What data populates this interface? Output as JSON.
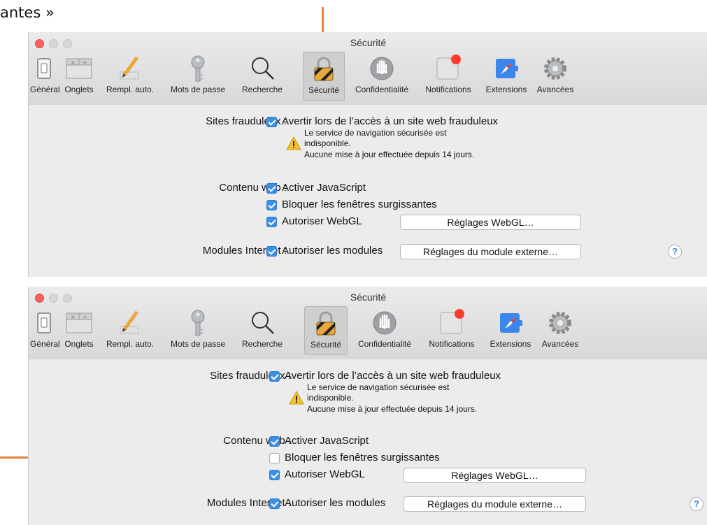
{
  "header_text": "antes »",
  "windows": [
    {
      "title": "Sécurité",
      "toolbar": [
        {
          "label": "Général",
          "icon": "general-switch-icon"
        },
        {
          "label": "Onglets",
          "icon": "tabs-icon"
        },
        {
          "label": "Rempl. auto.",
          "icon": "autofill-pencil-icon"
        },
        {
          "label": "Mots de passe",
          "icon": "key-icon"
        },
        {
          "label": "Recherche",
          "icon": "search-icon"
        },
        {
          "label": "Sécurité",
          "icon": "lock-icon",
          "selected": true
        },
        {
          "label": "Confidentialité",
          "icon": "hand-icon"
        },
        {
          "label": "Notifications",
          "icon": "notification-icon"
        },
        {
          "label": "Extensions",
          "icon": "extensions-compass-icon"
        },
        {
          "label": "Avancées",
          "icon": "gear-icon"
        }
      ],
      "fraud_label": "Sites frauduleux :",
      "fraud_option": "Avertir lors de l’accès à un site web frauduleux",
      "fraud_checked": true,
      "warning_line1": "Le service de navigation sécurisée est",
      "warning_line2": "indisponible.",
      "warning_line3": "Aucune mise à jour effectuée depuis 14 jours.",
      "web_label": "Contenu web :",
      "js_option": "Activer JavaScript",
      "js_checked": true,
      "popup_option": "Bloquer les fenêtres surgissantes",
      "popup_checked": true,
      "webgl_option": "Autoriser WebGL",
      "webgl_checked": true,
      "webgl_button": "Réglages WebGL…",
      "modules_label": "Modules Internet :",
      "modules_option": "Autoriser les modules",
      "modules_checked": true,
      "modules_button": "Réglages du module externe…",
      "help": "?"
    },
    {
      "title": "Sécurité",
      "toolbar": [
        {
          "label": "Général",
          "icon": "general-switch-icon"
        },
        {
          "label": "Onglets",
          "icon": "tabs-icon"
        },
        {
          "label": "Rempl. auto.",
          "icon": "autofill-pencil-icon"
        },
        {
          "label": "Mots de passe",
          "icon": "key-icon"
        },
        {
          "label": "Recherche",
          "icon": "search-icon"
        },
        {
          "label": "Sécurité",
          "icon": "lock-icon",
          "selected": true
        },
        {
          "label": "Confidentialité",
          "icon": "hand-icon"
        },
        {
          "label": "Notifications",
          "icon": "notification-icon"
        },
        {
          "label": "Extensions",
          "icon": "extensions-compass-icon"
        },
        {
          "label": "Avancées",
          "icon": "gear-icon"
        }
      ],
      "fraud_label": "Sites frauduleux :",
      "fraud_option": "Avertir lors de l’accès à un site web frauduleux",
      "fraud_checked": true,
      "warning_line1": "Le service de navigation sécurisée est",
      "warning_line2": "indisponible.",
      "warning_line3": "Aucune mise à jour effectuée depuis 14 jours.",
      "web_label": "Contenu web :",
      "js_option": "Activer JavaScript",
      "js_checked": true,
      "popup_option": "Bloquer les fenêtres surgissantes",
      "popup_checked": false,
      "webgl_option": "Autoriser WebGL",
      "webgl_checked": true,
      "webgl_button": "Réglages WebGL…",
      "modules_label": "Modules Internet :",
      "modules_option": "Autoriser les modules",
      "modules_checked": true,
      "modules_button": "Réglages du module externe…",
      "help": "?"
    }
  ],
  "colors": {
    "accent_arrow": "#e8823a",
    "checkbox_blue": "#3d8fe6",
    "close_red": "#fc605c",
    "notification_red": "#ff3b30"
  }
}
